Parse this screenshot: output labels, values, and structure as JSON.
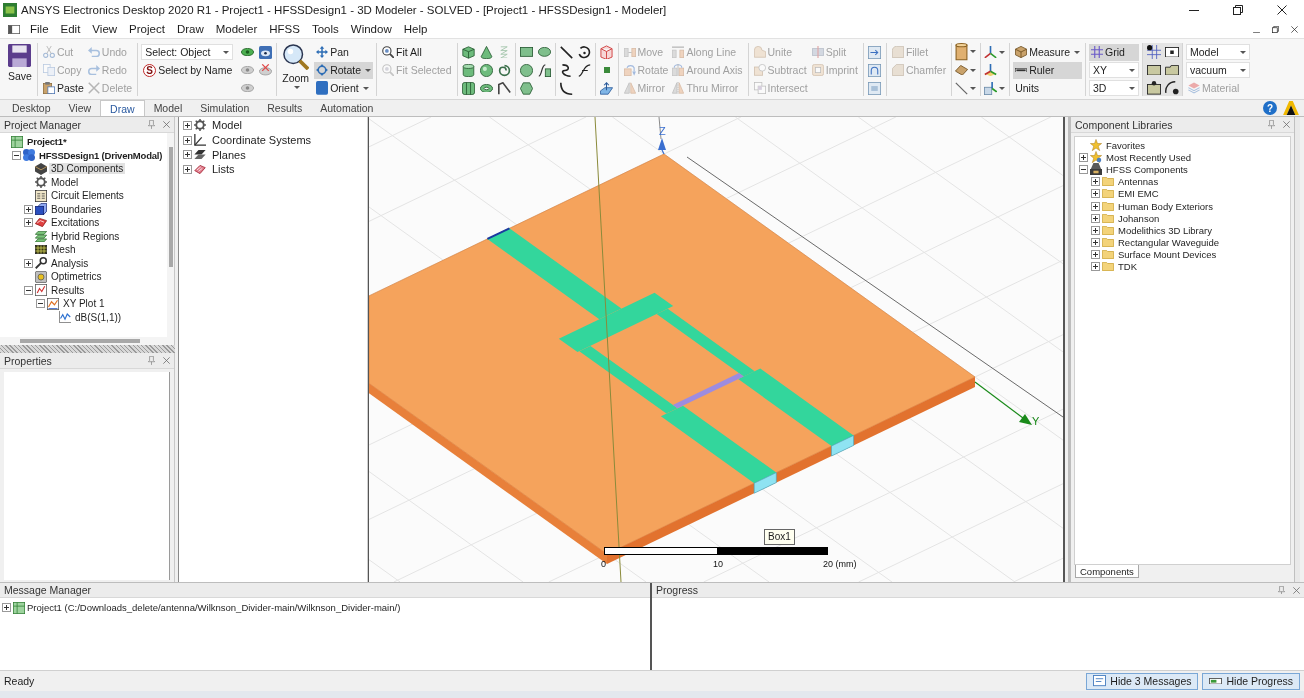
{
  "window": {
    "title": "ANSYS Electronics Desktop 2020 R1 - Project1 - HFSSDesign1 - 3D Modeler - SOLVED - [Project1 - HFSSDesign1 - Modeler]"
  },
  "menu": [
    "File",
    "Edit",
    "View",
    "Project",
    "Draw",
    "Modeler",
    "HFSS",
    "Tools",
    "Window",
    "Help"
  ],
  "ribbon": {
    "save": "Save",
    "clipboard": [
      {
        "kind": "cut",
        "label": "Cut",
        "disabled": true
      },
      {
        "kind": "copy",
        "label": "Copy",
        "disabled": true
      },
      {
        "kind": "paste",
        "label": "Paste",
        "disabled": false
      },
      {
        "kind": "undo",
        "label": "Undo",
        "disabled": true
      },
      {
        "kind": "redo",
        "label": "Redo",
        "disabled": true
      },
      {
        "kind": "delete",
        "label": "Delete",
        "disabled": true
      }
    ],
    "select": {
      "value": "Select: Object"
    },
    "select_by_name": {
      "letter": "S",
      "label": "Select by Name"
    },
    "zoom": "Zoom",
    "view_tools": [
      {
        "kind": "pan",
        "label": "Pan",
        "on": false,
        "dropdown": false
      },
      {
        "kind": "rotate",
        "label": "Rotate",
        "on": true,
        "dropdown": true
      },
      {
        "kind": "orient",
        "label": "Orient",
        "on": false,
        "dropdown": true
      }
    ],
    "fit": [
      {
        "kind": "fit_all",
        "label": "Fit All",
        "disabled": false
      },
      {
        "kind": "fit_selected",
        "label": "Fit Selected",
        "disabled": true
      }
    ],
    "transform": [
      {
        "kind": "move",
        "label": "Move",
        "disabled": true
      },
      {
        "kind": "rotate_object",
        "label": "Rotate",
        "disabled": true
      },
      {
        "kind": "mirror",
        "label": "Mirror",
        "disabled": true
      },
      {
        "kind": "along_line",
        "label": "Along Line",
        "disabled": true
      },
      {
        "kind": "around_axis",
        "label": "Around Axis",
        "disabled": true
      },
      {
        "kind": "thru_mirror",
        "label": "Thru Mirror",
        "disabled": true
      }
    ],
    "boolean": [
      {
        "kind": "unite",
        "label": "Unite",
        "disabled": true
      },
      {
        "kind": "subtract",
        "label": "Subtract",
        "disabled": true
      },
      {
        "kind": "intersect",
        "label": "Intersect",
        "disabled": true
      },
      {
        "kind": "split",
        "label": "Split",
        "disabled": true
      },
      {
        "kind": "imprint",
        "label": "Imprint",
        "disabled": true
      }
    ],
    "edges": [
      {
        "kind": "fillet",
        "label": "Fillet",
        "disabled": true
      },
      {
        "kind": "chamfer",
        "label": "Chamfer",
        "disabled": true
      }
    ],
    "measure": [
      {
        "kind": "measure",
        "label": "Measure",
        "on": false,
        "dropdown": true
      },
      {
        "kind": "ruler",
        "label": "Ruler",
        "on": true,
        "dropdown": false
      },
      {
        "kind": "units",
        "label": "Units",
        "on": false,
        "dropdown": false
      }
    ],
    "grid": {
      "label": "Grid",
      "on": true
    },
    "plane": {
      "value": "XY"
    },
    "view_mode": {
      "value": "3D"
    },
    "material_mode": {
      "value": "Model"
    },
    "material": {
      "value": "vacuum"
    },
    "material_button": {
      "label": "Material",
      "disabled": true
    }
  },
  "ribbon_tabs": [
    {
      "label": "Desktop",
      "selected": false
    },
    {
      "label": "View",
      "selected": false
    },
    {
      "label": "Draw",
      "selected": true
    },
    {
      "label": "Model",
      "selected": false
    },
    {
      "label": "Simulation",
      "selected": false
    },
    {
      "label": "Results",
      "selected": false
    },
    {
      "label": "Automation",
      "selected": false
    }
  ],
  "help": "?",
  "project_manager": {
    "title": "Project Manager",
    "tree": [
      {
        "label": "Project1*",
        "kind": "project",
        "selected": false,
        "children": [
          {
            "label": "HFSSDesign1 (DrivenModal)",
            "kind": "design",
            "expanded": true,
            "selected": false,
            "children": [
              {
                "label": "3D Components",
                "kind": "components",
                "selected": true
              },
              {
                "label": "Model",
                "kind": "model",
                "selected": false
              },
              {
                "label": "Circuit Elements",
                "kind": "circuit",
                "selected": false
              },
              {
                "label": "Boundaries",
                "kind": "boundaries",
                "expanded": false,
                "selected": false
              },
              {
                "label": "Excitations",
                "kind": "excitations",
                "expanded": false,
                "selected": false
              },
              {
                "label": "Hybrid Regions",
                "kind": "hybrid",
                "selected": false
              },
              {
                "label": "Mesh",
                "kind": "mesh",
                "selected": false
              },
              {
                "label": "Analysis",
                "kind": "analysis",
                "expanded": false,
                "selected": false
              },
              {
                "label": "Optimetrics",
                "kind": "optimetrics",
                "selected": false
              },
              {
                "label": "Results",
                "kind": "results",
                "expanded": true,
                "selected": false,
                "children": [
                  {
                    "label": "XY Plot 1",
                    "kind": "plot",
                    "expanded": true,
                    "selected": false,
                    "children": [
                      {
                        "label": "dB(S(1,1))",
                        "kind": "trace",
                        "selected": false
                      }
                    ]
                  }
                ]
              }
            ]
          }
        ]
      }
    ]
  },
  "properties": {
    "title": "Properties"
  },
  "model_tree": [
    {
      "label": "Model",
      "kind": "model",
      "expanded": false,
      "selected": false
    },
    {
      "label": "Coordinate Systems",
      "kind": "coords",
      "expanded": false,
      "selected": false
    },
    {
      "label": "Planes",
      "kind": "planes",
      "expanded": false,
      "selected": false
    },
    {
      "label": "Lists",
      "kind": "lists",
      "expanded": false,
      "selected": false
    }
  ],
  "viewport": {
    "axes": [
      {
        "kind": "z",
        "label": "Z"
      },
      {
        "kind": "y",
        "label": "Y"
      }
    ],
    "scale_labels": [
      "0",
      "10",
      "20 (mm)"
    ],
    "tooltip": "Box1"
  },
  "component_libraries": {
    "title": "Component Libraries",
    "tree": [
      {
        "label": "Favorites",
        "kind": "favorites",
        "selected": false
      },
      {
        "label": "Most Recently Used",
        "kind": "recent",
        "expanded": false,
        "selected": false
      },
      {
        "label": "HFSS Components",
        "kind": "library",
        "expanded": true,
        "selected": false,
        "children": [
          {
            "label": "Antennas",
            "kind": "folder",
            "expanded": false,
            "selected": false
          },
          {
            "label": "EMI EMC",
            "kind": "folder",
            "expanded": false,
            "selected": false
          },
          {
            "label": "Human Body Exteriors",
            "kind": "folder",
            "expanded": false,
            "selected": false
          },
          {
            "label": "Johanson",
            "kind": "folder",
            "expanded": false,
            "selected": false
          },
          {
            "label": "Modelithics 3D Library",
            "kind": "folder",
            "expanded": false,
            "selected": false
          },
          {
            "label": "Rectangular Waveguide",
            "kind": "folder",
            "expanded": false,
            "selected": false
          },
          {
            "label": "Surface Mount Devices",
            "kind": "folder",
            "expanded": false,
            "selected": false
          },
          {
            "label": "TDK",
            "kind": "folder",
            "expanded": false,
            "selected": false
          }
        ]
      }
    ],
    "tabs": [
      {
        "label": "Components",
        "selected": true
      }
    ]
  },
  "message_manager": {
    "title": "Message Manager",
    "messages": [
      {
        "text": "Project1 (C:/Downloads_delete/antenna/Wilknson_Divider-main/Wilknson_Divider-main/)",
        "expanded": false
      }
    ]
  },
  "progress": {
    "title": "Progress"
  },
  "status_bar": {
    "text": "Ready",
    "buttons": [
      {
        "kind": "messages",
        "label": "Hide 3 Messages"
      },
      {
        "kind": "progress",
        "label": "Hide Progress"
      }
    ]
  }
}
